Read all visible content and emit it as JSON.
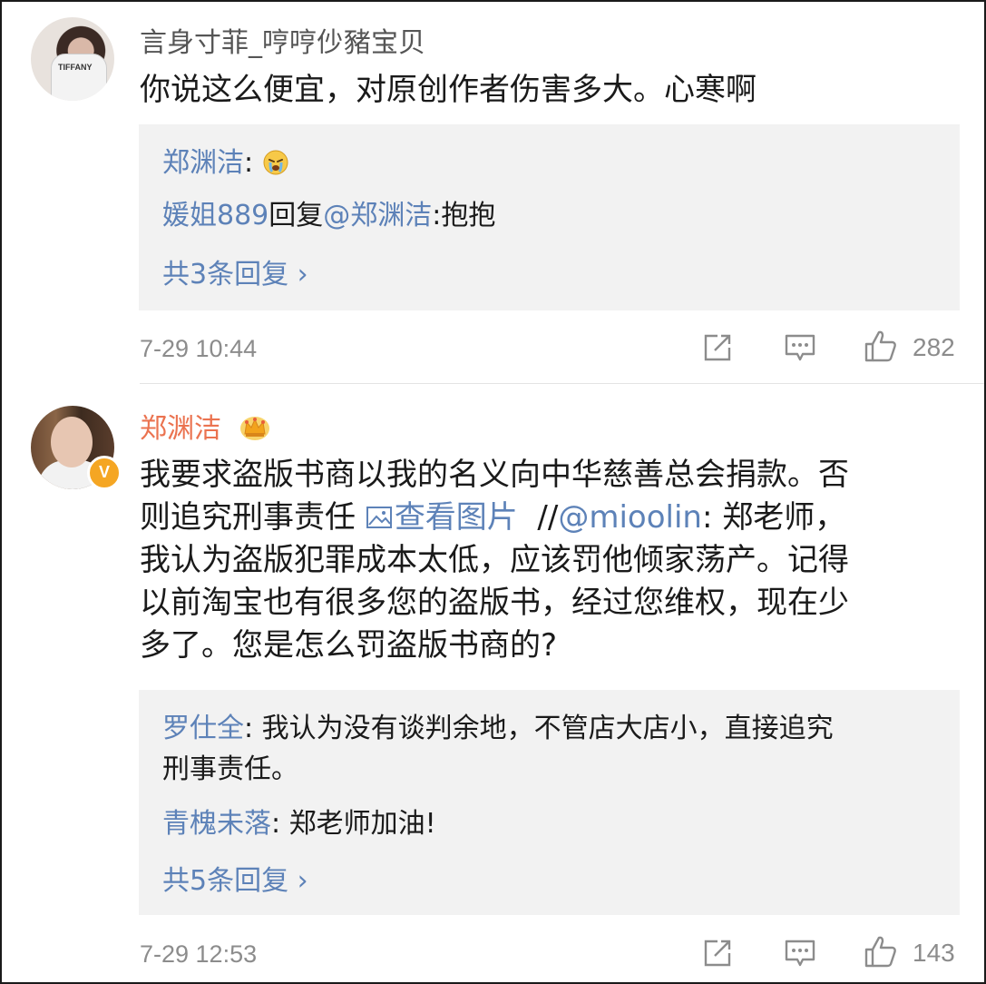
{
  "comments": [
    {
      "username": "言身寸菲_哼哼仯豬宝贝",
      "text": "你说这么便宜，对原创作者伤害多大。心寒啊",
      "avatar_text": "TIFFANY",
      "replies": [
        {
          "name": "郑渊洁",
          "sep": ":",
          "emoji": "crying-face",
          "text": ""
        },
        {
          "name": "媛姐889",
          "mid": "回复",
          "mention": "@郑渊洁",
          "sep": ":",
          "text": "抱抱"
        }
      ],
      "more": "共3条回复 ›",
      "time": "7-29 10:44",
      "likes": "282"
    },
    {
      "username": "郑渊洁",
      "badge": "V",
      "line1": "我要求盗版书商以我的名义向中华慈善总会捐款。否",
      "line2_pre": "则追究刑事责任 ",
      "image_link": "查看图片",
      "line2_gap": "  //",
      "mention": "@mioolin",
      "line2_post": ": 郑老师，",
      "line3": "我认为盗版犯罪成本太低，应该罚他倾家荡产。记得",
      "line4": "以前淘宝也有很多您的盗版书，经过您维权，现在少",
      "line5": "多了。您是怎么罚盗版书商的?",
      "replies": [
        {
          "name": "罗仕全",
          "sep": ": ",
          "text1": "我认为没有谈判余地，不管店大店小，直接追究",
          "text2": "刑事责任。"
        },
        {
          "name": "青槐未落",
          "sep": ": ",
          "text": "郑老师加油!"
        }
      ],
      "more": "共5条回复 ›",
      "time": "7-29 12:53",
      "likes": "143"
    }
  ],
  "colors": {
    "link": "#5d82b8",
    "orange_name": "#eb7350",
    "meta": "#8c8c8c",
    "reply_bg": "#f2f2f2"
  },
  "icons": [
    "share-icon",
    "comment-icon",
    "like-icon",
    "crown-icon",
    "crying-face-icon",
    "image-icon"
  ]
}
